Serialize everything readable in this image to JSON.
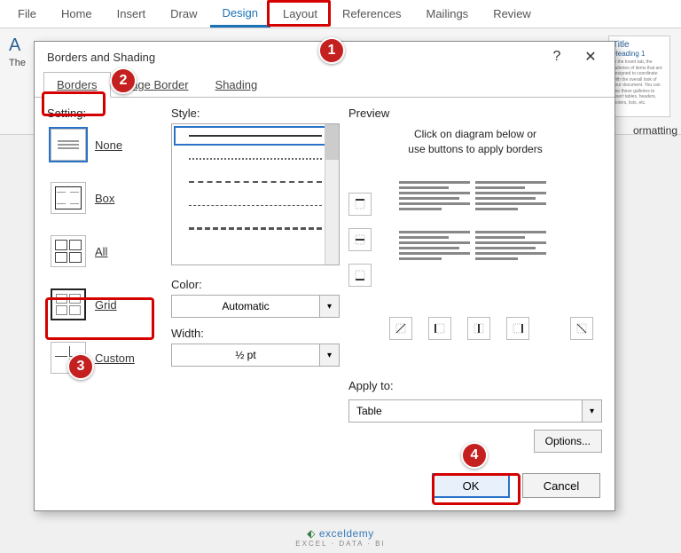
{
  "ribbon": {
    "tabs": [
      "File",
      "Home",
      "Insert",
      "Draw",
      "Design",
      "Layout",
      "References",
      "Mailings",
      "Review"
    ],
    "activeIndex": 4,
    "stylePreview": {
      "title": "Title",
      "heading": "Heading 1"
    },
    "clearFormatting": "ormatting"
  },
  "dialog": {
    "title": "Borders and Shading",
    "help": "?",
    "close": "✕",
    "tabs": [
      "Borders",
      "Page Border",
      "Shading"
    ],
    "activeTab": 0,
    "setting": {
      "label": "Setting:",
      "items": [
        {
          "name": "none",
          "label": "None"
        },
        {
          "name": "box",
          "label": "Box"
        },
        {
          "name": "all",
          "label": "All"
        },
        {
          "name": "grid",
          "label": "Grid"
        },
        {
          "name": "custom",
          "label": "Custom"
        }
      ]
    },
    "style": {
      "label": "Style:"
    },
    "color": {
      "label": "Color:",
      "value": "Automatic"
    },
    "width": {
      "label": "Width:",
      "value": "½ pt"
    },
    "preview": {
      "label": "Preview",
      "note1": "Click on diagram below or",
      "note2": "use buttons to apply borders",
      "applyLabel": "Apply to:",
      "applyValue": "Table",
      "options": "Options..."
    },
    "ok": "OK",
    "cancel": "Cancel"
  },
  "badges": {
    "b1": "1",
    "b2": "2",
    "b3": "3",
    "b4": "4"
  },
  "watermark": {
    "brand": "exceldemy",
    "tag": "EXCEL · DATA · BI"
  }
}
